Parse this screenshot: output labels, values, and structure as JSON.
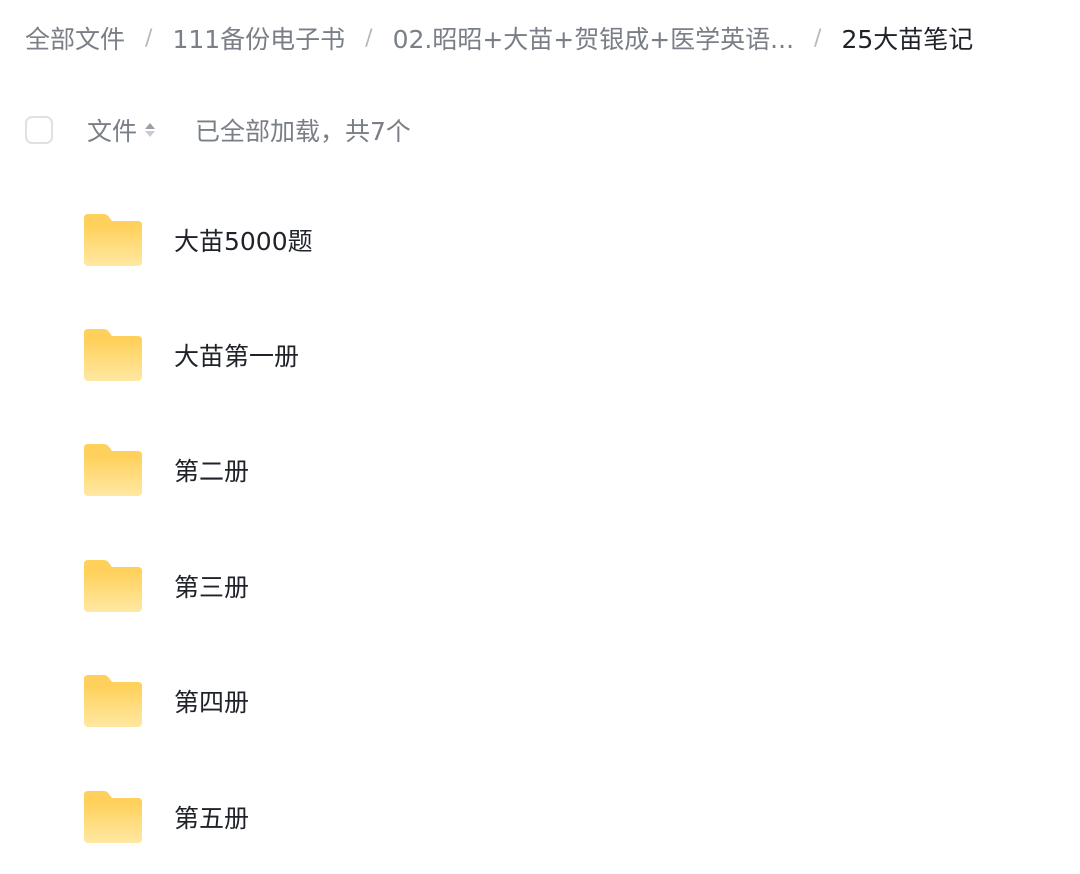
{
  "breadcrumb": {
    "items": [
      {
        "label": "全部文件"
      },
      {
        "label": "111备份电子书"
      },
      {
        "label": "02.昭昭+大苗+贺银成+医学英语..."
      },
      {
        "label": "25大苗笔记"
      }
    ],
    "separator": "/"
  },
  "header": {
    "sort_label": "文件",
    "status_text": "已全部加载，共7个"
  },
  "files": [
    {
      "name": "大苗5000题",
      "icon": "folder-icon"
    },
    {
      "name": "大苗第一册",
      "icon": "folder-icon"
    },
    {
      "name": "第二册",
      "icon": "folder-icon"
    },
    {
      "name": "第三册",
      "icon": "folder-icon"
    },
    {
      "name": "第四册",
      "icon": "folder-icon"
    },
    {
      "name": "第五册",
      "icon": "folder-icon"
    }
  ],
  "colors": {
    "folder": "#ffd15c",
    "folder_light": "#ffe8a3",
    "muted_text": "#7a7f87",
    "primary_text": "#1f2329"
  }
}
